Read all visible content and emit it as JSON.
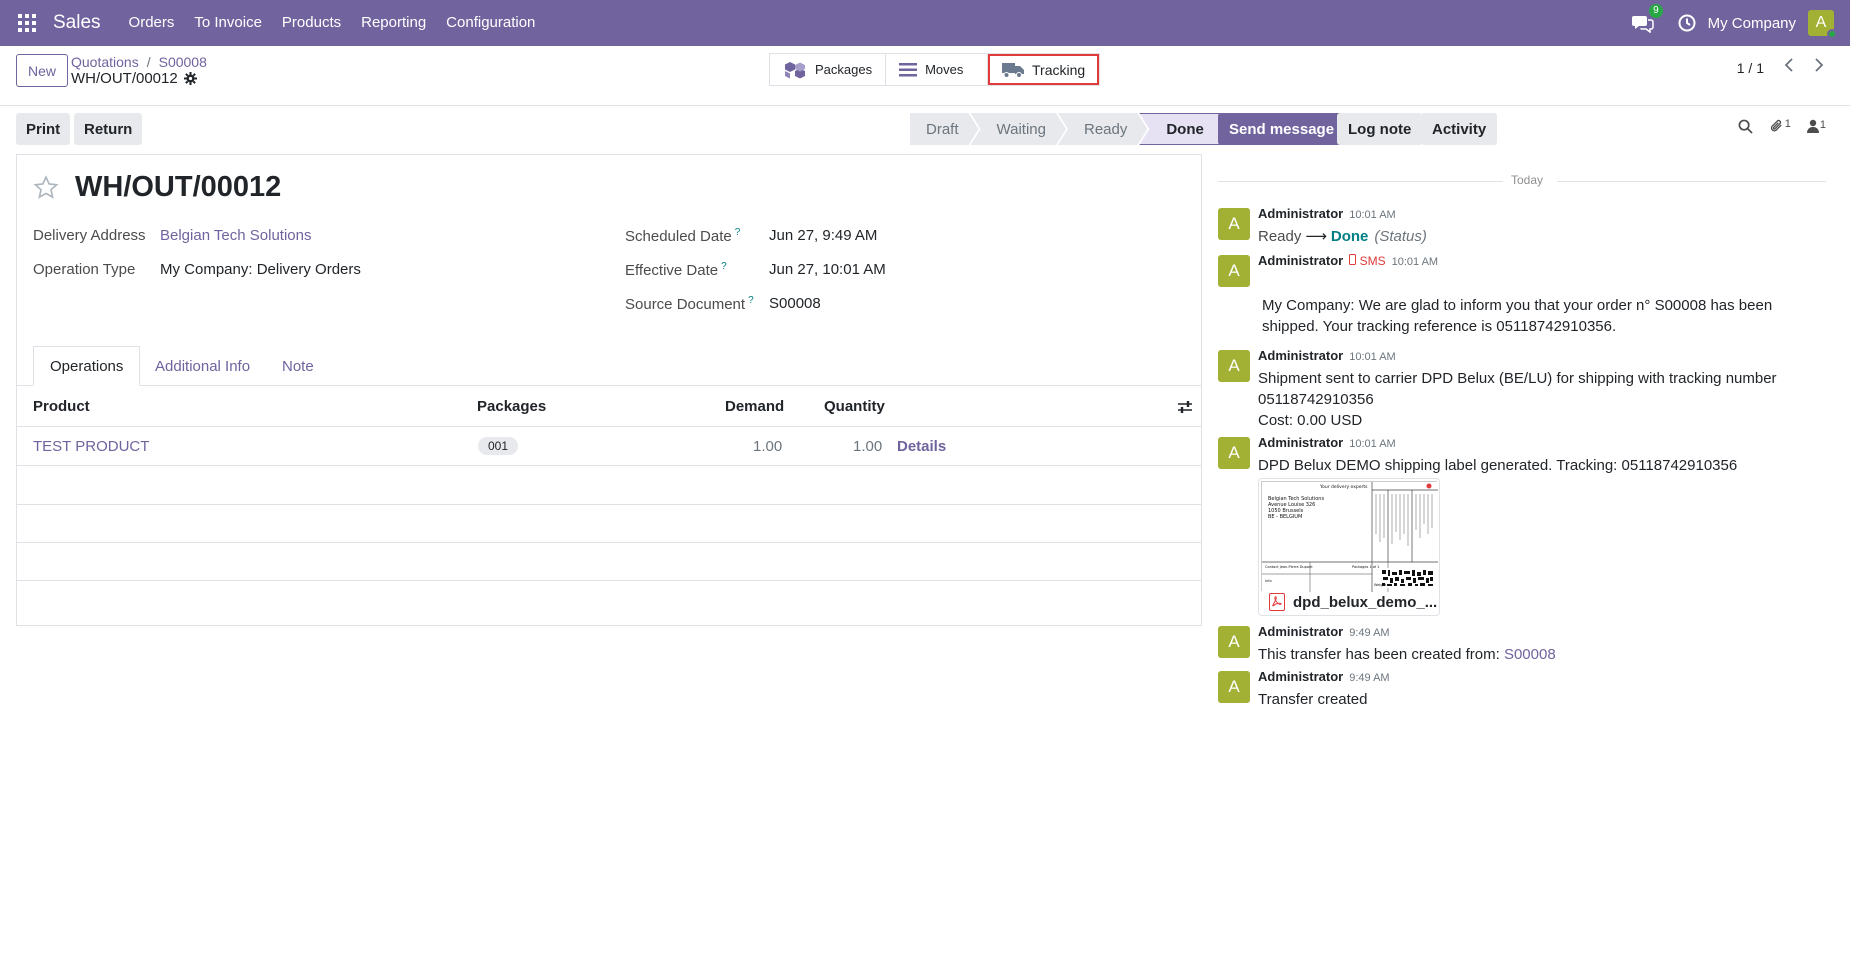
{
  "navbar": {
    "app_name": "Sales",
    "menu": [
      "Orders",
      "To Invoice",
      "Products",
      "Reporting",
      "Configuration"
    ],
    "chat_badge": "9",
    "company": "My Company",
    "avatar_letter": "A"
  },
  "control_panel": {
    "new_label": "New",
    "breadcrumb": [
      "Quotations",
      "S00008"
    ],
    "breadcrumb_sep": "/",
    "record": "WH/OUT/00012",
    "smart_buttons": {
      "packages": "Packages",
      "moves": "Moves",
      "tracking": "Tracking"
    },
    "pager": "1 / 1"
  },
  "actions": {
    "print": "Print",
    "return": "Return"
  },
  "status_stages": [
    "Draft",
    "Waiting",
    "Ready",
    "Done"
  ],
  "status_current": "Done",
  "form": {
    "title": "WH/OUT/00012",
    "delivery_address_label": "Delivery Address",
    "delivery_address": "Belgian Tech Solutions",
    "operation_type_label": "Operation Type",
    "operation_type": "My Company: Delivery Orders",
    "scheduled_date_label": "Scheduled Date",
    "scheduled_date": "Jun 27, 9:49 AM",
    "effective_date_label": "Effective Date",
    "effective_date": "Jun 27, 10:01 AM",
    "source_document_label": "Source Document",
    "source_document": "S00008",
    "help_mark": "?",
    "tabs": [
      "Operations",
      "Additional Info",
      "Note"
    ],
    "columns": {
      "product": "Product",
      "packages": "Packages",
      "demand": "Demand",
      "quantity": "Quantity"
    },
    "lines": [
      {
        "product": "TEST PRODUCT",
        "package": "001",
        "demand": "1.00",
        "quantity": "1.00",
        "details": "Details"
      }
    ]
  },
  "chatter": {
    "send_message": "Send message",
    "log_note": "Log note",
    "activity": "Activity",
    "attachments_count": "1",
    "followers_count": "1",
    "today": "Today",
    "messages": [
      {
        "author": "Administrator",
        "time": "10:01 AM",
        "status_from": "Ready",
        "arrow": "⟶",
        "status_to": "Done",
        "field": "(Status)"
      },
      {
        "author": "Administrator",
        "sms": "SMS",
        "time": "10:01 AM",
        "body": "My Company: We are glad to inform you that your order n° S00008 has been shipped. Your tracking reference is 05118742910356."
      },
      {
        "author": "Administrator",
        "time": "10:01 AM",
        "body_line1": "Shipment sent to carrier DPD Belux (BE/LU) for shipping with tracking number",
        "body_line2": "05118742910356",
        "body_line3": "Cost: 0.00 USD"
      },
      {
        "author": "Administrator",
        "time": "10:01 AM",
        "body": "DPD Belux DEMO shipping label generated. Tracking: 05118742910356",
        "attachment": "dpd_belux_demo_..."
      },
      {
        "author": "Administrator",
        "time": "9:49 AM",
        "body": "This transfer has been created from:",
        "link": "S00008"
      },
      {
        "author": "Administrator",
        "time": "9:49 AM",
        "body": "Transfer created"
      }
    ],
    "label_preview": {
      "header": "Your delivery experts",
      "address": [
        "Belgian Tech Solutions",
        "Avenue Louise 326",
        "1050 Brussels",
        "BE - BELGIUM"
      ],
      "contact": "Contact   Jean-Pierre Dupont",
      "packages": "Packages 1 of 1",
      "info": "Info",
      "weight": "Weight"
    }
  },
  "colors": {
    "brand": "#71639e",
    "accent_teal": "#017e84",
    "avatar": "#a2b034",
    "highlight_box": "#e03a3a"
  }
}
